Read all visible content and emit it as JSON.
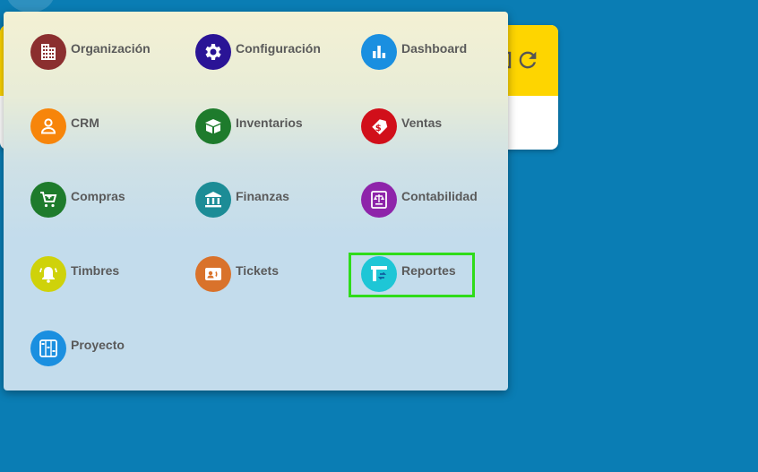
{
  "app_menu": {
    "items": [
      {
        "label": "Organización",
        "icon": "building-icon",
        "color": "#8b2f2f"
      },
      {
        "label": "Configuración",
        "icon": "gear-icon",
        "color": "#2a1496"
      },
      {
        "label": "Dashboard",
        "icon": "bar-chart-icon",
        "color": "#1a8fe0"
      },
      {
        "label": "CRM",
        "icon": "user-icon",
        "color": "#f7850a"
      },
      {
        "label": "Inventarios",
        "icon": "box-icon",
        "color": "#1e7b2c"
      },
      {
        "label": "Ventas",
        "icon": "price-tag-icon",
        "color": "#d10f1a"
      },
      {
        "label": "Compras",
        "icon": "shopping-cart-icon",
        "color": "#1e7b2c"
      },
      {
        "label": "Finanzas",
        "icon": "bank-icon",
        "color": "#1c8c96"
      },
      {
        "label": "Contabilidad",
        "icon": "scale-icon",
        "color": "#8e24aa"
      },
      {
        "label": "Timbres",
        "icon": "bell-icon",
        "color": "#cfd20a"
      },
      {
        "label": "Tickets",
        "icon": "contact-card-icon",
        "color": "#d9722b"
      },
      {
        "label": "Reportes",
        "icon": "report-icon",
        "color": "#1ec6d6"
      },
      {
        "label": "Proyecto",
        "icon": "project-icon",
        "color": "#1a8fe0"
      }
    ],
    "highlighted": "Reportes"
  },
  "background_card": {
    "header_color": "#fed500",
    "icons": [
      "expand-icon",
      "refresh-icon"
    ]
  },
  "colors": {
    "page_background": "#0a7db4",
    "highlight_border": "#2fdc1a"
  }
}
